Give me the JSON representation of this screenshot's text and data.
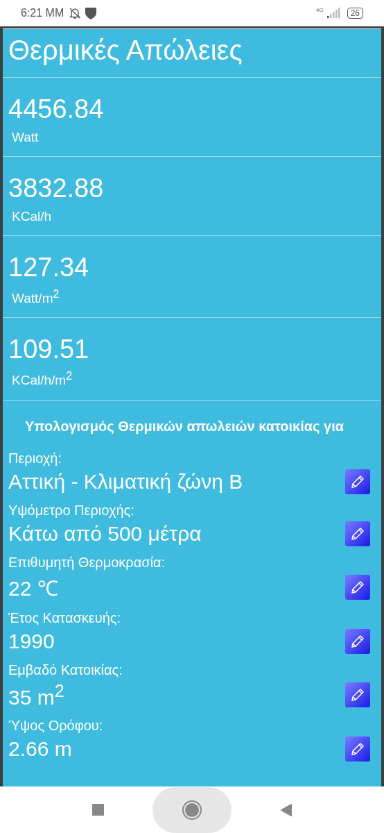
{
  "status_bar": {
    "time": "6:21 MM",
    "network": "4G",
    "battery": "26"
  },
  "title": "Θερμικές Απώλειες",
  "results": [
    {
      "value": "4456.84",
      "unit": "Watt"
    },
    {
      "value": "3832.88",
      "unit": "KCal/h"
    },
    {
      "value": "127.34",
      "unit": "Watt/m$^{2}$"
    },
    {
      "value": "109.51",
      "unit": "KCal/h/m$^{2}$"
    }
  ],
  "section_heading": "Υπολογισμός Θερμικών απωλειών κατοικίας για",
  "parameters": [
    {
      "label": "Περιοχή:",
      "value": "Αττική - Κλιματική ζώνη Β"
    },
    {
      "label": "Υψόμετρο Περιοχής:",
      "value": "Κάτω από 500 μέτρα"
    },
    {
      "label": "Επιθυμητή Θερμοκρασία:",
      "value": "22 ℃"
    },
    {
      "label": "Έτος Κατασκευής:",
      "value": "1990"
    },
    {
      "label": "Εμβαδό Κατοικίας:",
      "value": "35 m$^{2}$"
    },
    {
      "label": "Ύψος Ορόφου:",
      "value": "2.66 m"
    }
  ]
}
